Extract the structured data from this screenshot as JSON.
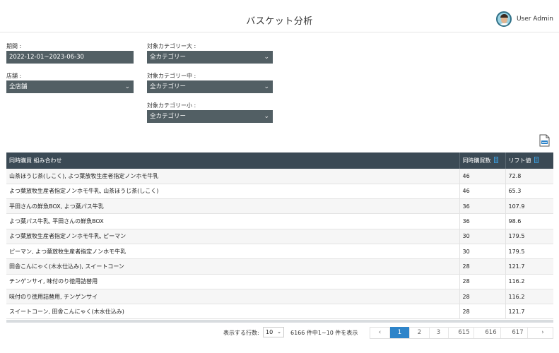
{
  "header": {
    "title": "バスケット分析",
    "user_name": "User Admin"
  },
  "filters": {
    "period": {
      "label": "期間 :",
      "value": "2022-12-01~2023-06-30"
    },
    "store": {
      "label": "店舗 :",
      "value": "全店舗"
    },
    "cat_large": {
      "label": "対象カテゴリー大 :",
      "value": "全カテゴリー"
    },
    "cat_mid": {
      "label": "対象カテゴリー中 :",
      "value": "全カテゴリー"
    },
    "cat_small": {
      "label": "対象カテゴリー小 :",
      "value": "全カテゴリー"
    }
  },
  "table": {
    "headers": [
      "同時購買 組み合わせ",
      "同時購買数",
      "リフト値"
    ],
    "rows": [
      [
        "山茶ほうじ茶(しこく), よつ葉放牧生産者指定ノンホモ牛乳",
        "46",
        "72.8"
      ],
      [
        "よつ葉放牧生産者指定ノンホモ牛乳, 山茶ほうじ茶(しこく)",
        "46",
        "65.3"
      ],
      [
        "平田さんの鮮魚BOX, よつ葉パス牛乳",
        "36",
        "107.9"
      ],
      [
        "よつ葉パス牛乳, 平田さんの鮮魚BOX",
        "36",
        "98.6"
      ],
      [
        "よつ葉放牧生産者指定ノンホモ牛乳, ピーマン",
        "30",
        "179.5"
      ],
      [
        "ピーマン, よつ葉放牧生産者指定ノンホモ牛乳",
        "30",
        "179.5"
      ],
      [
        "田舎こんにゃく(木水仕込み), スイートコーン",
        "28",
        "121.7"
      ],
      [
        "チンゲンサイ, 味付のり徳用詰替用",
        "28",
        "116.2"
      ],
      [
        "味付のり徳用詰替用, チンゲンサイ",
        "28",
        "116.2"
      ],
      [
        "スイートコーン, 田舎こんにゃく(木水仕込み)",
        "28",
        "121.7"
      ]
    ]
  },
  "pagination": {
    "rows_label": "表示する行数:",
    "rows_value": "10",
    "range_text": "6166 件中1~10 件を表示",
    "prev": "‹",
    "next": "›",
    "pages": [
      "1",
      "2",
      "3",
      "615",
      "616",
      "617"
    ],
    "current_page": "1"
  },
  "icons": [
    "user-avatar-icon",
    "chevron-down-icon",
    "csv-download-icon",
    "sort-icon"
  ],
  "colors": {
    "filter_bg": "#525f64",
    "table_header_bg": "#3b4a55",
    "active_page": "#2e84c9",
    "sort_icon": "#3a9ad9"
  }
}
